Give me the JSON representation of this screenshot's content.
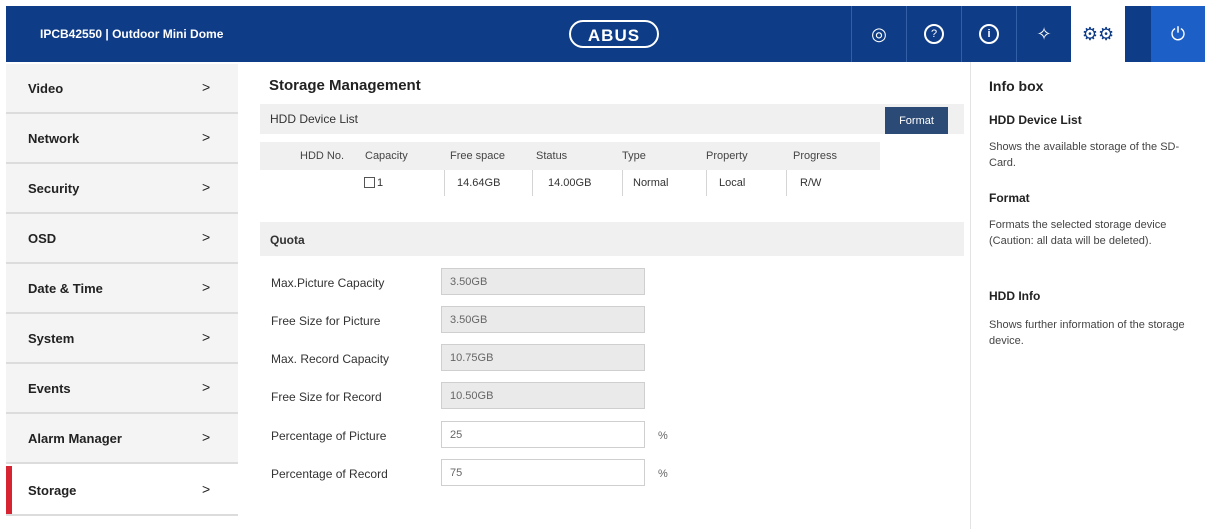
{
  "header": {
    "device_title": "IPCB42550  |  Outdoor Mini Dome",
    "logo_text": "ABUS",
    "icons": [
      "camera-icon",
      "help-icon",
      "info-icon",
      "wizard-icon",
      "settings-gears-icon",
      "power-icon"
    ],
    "icon_glyphs": [
      "◎",
      "?",
      "i",
      "✧",
      "⚙⚙",
      "⏻"
    ],
    "colors": {
      "bar": "#0e3c87",
      "accent_red": "#d62433",
      "active_tab_bg": "#ffffff",
      "power_bg": "#1c5fc7"
    }
  },
  "sidebar": {
    "items": [
      {
        "label": "Video",
        "chevron": ">"
      },
      {
        "label": "Network",
        "chevron": ">"
      },
      {
        "label": "Security",
        "chevron": ">"
      },
      {
        "label": "OSD",
        "chevron": ">"
      },
      {
        "label": "Date & Time",
        "chevron": ">"
      },
      {
        "label": "System",
        "chevron": ">"
      },
      {
        "label": "Events",
        "chevron": ">"
      },
      {
        "label": "Alarm Manager",
        "chevron": ">"
      },
      {
        "label": "Storage",
        "chevron": ">"
      }
    ],
    "active": "Storage"
  },
  "main": {
    "title": "Storage Management",
    "hdd_list": {
      "label": "HDD Device List",
      "format_button": "Format",
      "columns": [
        "HDD No.",
        "Capacity",
        "Free space",
        "Status",
        "Type",
        "Property",
        "Progress"
      ],
      "row": {
        "hdd_no": "1",
        "capacity": "14.64GB",
        "free_space": "14.00GB",
        "status": "Normal",
        "type": "Local",
        "property": "R/W",
        "progress": ""
      }
    },
    "quota": {
      "label": "Quota",
      "fields": [
        {
          "label": "Max.Picture Capacity",
          "value": "3.50GB"
        },
        {
          "label": "Free Size for Picture",
          "value": "3.50GB"
        },
        {
          "label": "Max. Record Capacity",
          "value": "10.75GB"
        },
        {
          "label": "Free Size for Record",
          "value": "10.50GB"
        },
        {
          "label": "Percentage of Picture",
          "value": "25",
          "unit": "%"
        },
        {
          "label": "Percentage of Record",
          "value": "75",
          "unit": "%"
        }
      ]
    }
  },
  "info_box": {
    "title": "Info box",
    "sections": [
      {
        "heading": "HDD Device List",
        "text": "Shows the available storage of the SD-Card."
      },
      {
        "heading": "Format",
        "text": "Formats the selected storage device (Caution: all data will be deleted)."
      },
      {
        "heading": "HDD Info",
        "text": "Shows further information of the storage device."
      }
    ]
  }
}
